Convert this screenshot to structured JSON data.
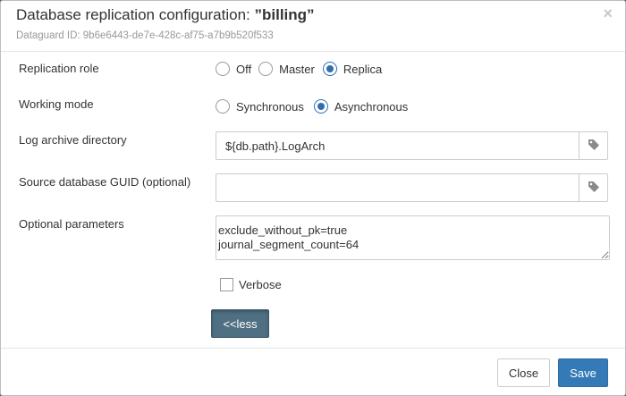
{
  "dialog": {
    "title_prefix": "Database replication configuration: ",
    "title_name": "”billing”",
    "subtitle": "Dataguard ID: 9b6e6443-de7e-428c-af75-a7b9b520f533",
    "close_symbol": "×"
  },
  "form": {
    "replication_role": {
      "label": "Replication role",
      "options": [
        "Off",
        "Master",
        "Replica"
      ],
      "selected": "Replica"
    },
    "working_mode": {
      "label": "Working mode",
      "options": [
        "Synchronous",
        "Asynchronous"
      ],
      "selected": "Asynchronous"
    },
    "log_archive_directory": {
      "label": "Log archive directory",
      "value": "${db.path}.LogArch",
      "addon_icon": "tag-icon"
    },
    "source_database_guid": {
      "label": "Source database GUID (optional)",
      "value": "",
      "addon_icon": "tag-icon"
    },
    "optional_parameters": {
      "label": "Optional parameters",
      "value": "exclude_without_pk=true\njournal_segment_count=64"
    },
    "verbose": {
      "label": "Verbose",
      "checked": false
    },
    "less_button": "<<less"
  },
  "footer": {
    "close_label": "Close",
    "save_label": "Save"
  },
  "colors": {
    "primary": "#337ab7",
    "radio_checked": "#2f6fb0",
    "less_button": "#4e7082"
  }
}
